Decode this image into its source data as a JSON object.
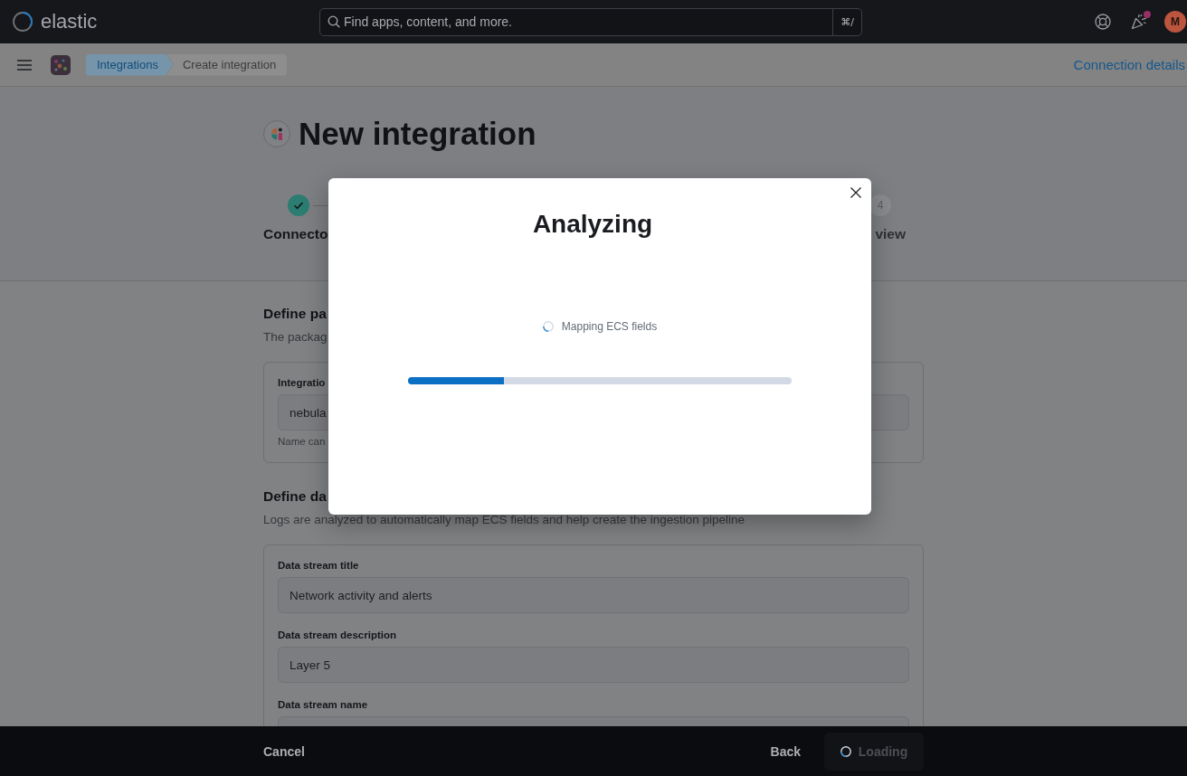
{
  "header": {
    "logo_text": "elastic",
    "search": {
      "placeholder": "Find apps, content, and more.",
      "shortcut": "⌘/"
    },
    "newsfeed_unread": true,
    "avatar_initial": "M"
  },
  "nav_bar": {
    "breadcrumbs": [
      {
        "label": "Integrations",
        "current": false
      },
      {
        "label": "Create integration",
        "current": true
      }
    ],
    "link": "Connection details"
  },
  "page_header": {
    "title": "New integration",
    "steps": [
      {
        "label": "Connecto",
        "complete": true
      },
      {
        "number": "4",
        "label": "view",
        "complete": false
      }
    ]
  },
  "sections": [
    {
      "title": "Define pa",
      "description": "The packag",
      "fields": [
        {
          "label": "Integratio",
          "value": "nebula",
          "help": "Name can"
        }
      ]
    },
    {
      "title": "Define da",
      "description": "Logs are analyzed to automatically map ECS fields and help create the ingestion pipeline",
      "fields": [
        {
          "label": "Data stream title",
          "value": "Network activity and alerts"
        },
        {
          "label": "Data stream description",
          "value": "Layer 5"
        },
        {
          "label": "Data stream name"
        }
      ]
    }
  ],
  "modal": {
    "title": "Analyzing",
    "status": "Mapping ECS fields",
    "progress": {
      "level": 0.25
    }
  },
  "footer": {
    "cancel": "Cancel",
    "back": "Back",
    "next": {
      "label": "Loading",
      "loading": true,
      "disabled": true
    }
  }
}
